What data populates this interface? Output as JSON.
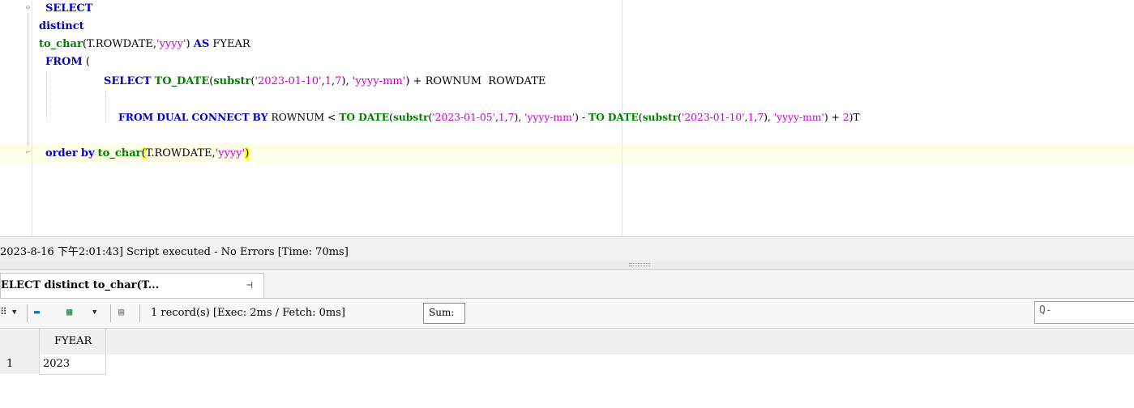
{
  "editor": {
    "lines": {
      "l1_select": "SELECT",
      "l2_distinct": "distinct",
      "l3_fn": "to_char",
      "l3_arg": "(T.ROWDATE,",
      "l3_str": "'yyyy'",
      "l3_close": ")",
      "l3_as": "AS",
      "l3_alias": "FYEAR",
      "l4_from": "FROM",
      "l4_paren": "(",
      "l5_select": "SELECT",
      "l5_todate": "TO_DATE",
      "l5_p1": "(",
      "l5_substr": "substr",
      "l5_p2": "(",
      "l5_date": "'2023-01-10'",
      "l5_c1": ",",
      "l5_n1": "1",
      "l5_c2": ",",
      "l5_n2": "7",
      "l5_c3": "),",
      "l5_fmt": "'yyyy-mm'",
      "l5_rest": ") + ROWNUM  ROWDATE",
      "l6_from": "FROM",
      "l6_dual": "DUAL",
      "l6_connect": "CONNECT",
      "l6_by": "BY",
      "l6_rownum": "ROWNUM <",
      "l6_to1": "TO",
      "l6_date1": "DATE",
      "l6_p1": "(",
      "l6_substr1": "substr",
      "l6_p2": "(",
      "l6_str1": "'2023-01-05'",
      "l6_c1": ",",
      "l6_n1": "1",
      "l6_c2": ",",
      "l6_n2": "7",
      "l6_c3": "),",
      "l6_fmt1": "'yyyy-mm'",
      "l6_minus": ") -",
      "l6_to2": "TO",
      "l6_date2": "DATE",
      "l6_p3": "(",
      "l6_substr2": "substr",
      "l6_p4": "(",
      "l6_str2": "'2023-01-10'",
      "l6_c4": ",",
      "l6_n3": "1",
      "l6_c5": ",",
      "l6_n4": "7",
      "l6_c6": "),",
      "l6_fmt2": "'yyyy-mm'",
      "l6_plus": ") +",
      "l6_n5": "2",
      "l6_end": ")T",
      "l7_order": "order",
      "l7_by": "by",
      "l7_fn": "to_char",
      "l7_open": "(",
      "l7_arg": "T.ROWDATE,",
      "l7_str": "'yyyy'",
      "l7_close": ")"
    }
  },
  "status": {
    "message": "2023-8-16 下午2:01:43] Script executed - No Errors [Time: 70ms]"
  },
  "result_tab": {
    "label": "ELECT distinct to_char(T..."
  },
  "toolbar": {
    "records": "1 record(s) [Exec: 2ms / Fetch: 0ms]",
    "sum_label": "Sum:",
    "search_icon": "Q-"
  },
  "grid": {
    "columns": [
      "FYEAR"
    ],
    "rows": [
      {
        "num": "1",
        "cells": [
          "2023"
        ]
      }
    ]
  },
  "colors": {
    "keyword": "#0000cc",
    "function": "#008000",
    "string": "#cc00cc",
    "brace_highlight": "#ffff33",
    "current_line": "#ffffe8"
  }
}
